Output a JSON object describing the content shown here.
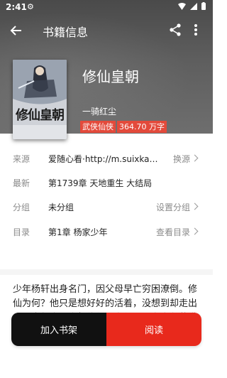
{
  "status_bar": {
    "time": "2:41",
    "settings_icon": "gear-icon"
  },
  "app_bar": {
    "title": "书籍信息",
    "back_icon": "arrow-left-icon",
    "share_icon": "share-icon",
    "more_icon": "more-vert-icon"
  },
  "book": {
    "cover_title": "修仙皇朝",
    "name": "修仙皇朝",
    "author": "一骑红尘",
    "tags": [
      "武侠仙侠",
      "364.70 万字"
    ]
  },
  "info_rows": [
    {
      "label": "来源",
      "value": "爱随心看·http://m.suixkan.c...",
      "action": "换源"
    },
    {
      "label": "最新",
      "value": "第1739章 天地重生 大结局",
      "action": ""
    },
    {
      "label": "分组",
      "value": "未分组",
      "action": "设置分组"
    },
    {
      "label": "目录",
      "value": "第1章 杨家少年",
      "action": "查看目录"
    }
  ],
  "intro": "少年杨轩出身名门，因父母早亡穷困潦倒。修仙为何？他只是想好好的活着，没想到却走出个万古长生。今朝修仙不为仙，只为春色花满园，红尘伴我登仙途，唯有独闯长生天！",
  "buttons": {
    "add_shelf": "加入书架",
    "read": "阅读"
  },
  "colors": {
    "accent": "#e8291c",
    "tag": "#e34a3b",
    "dark_button": "#111111"
  }
}
